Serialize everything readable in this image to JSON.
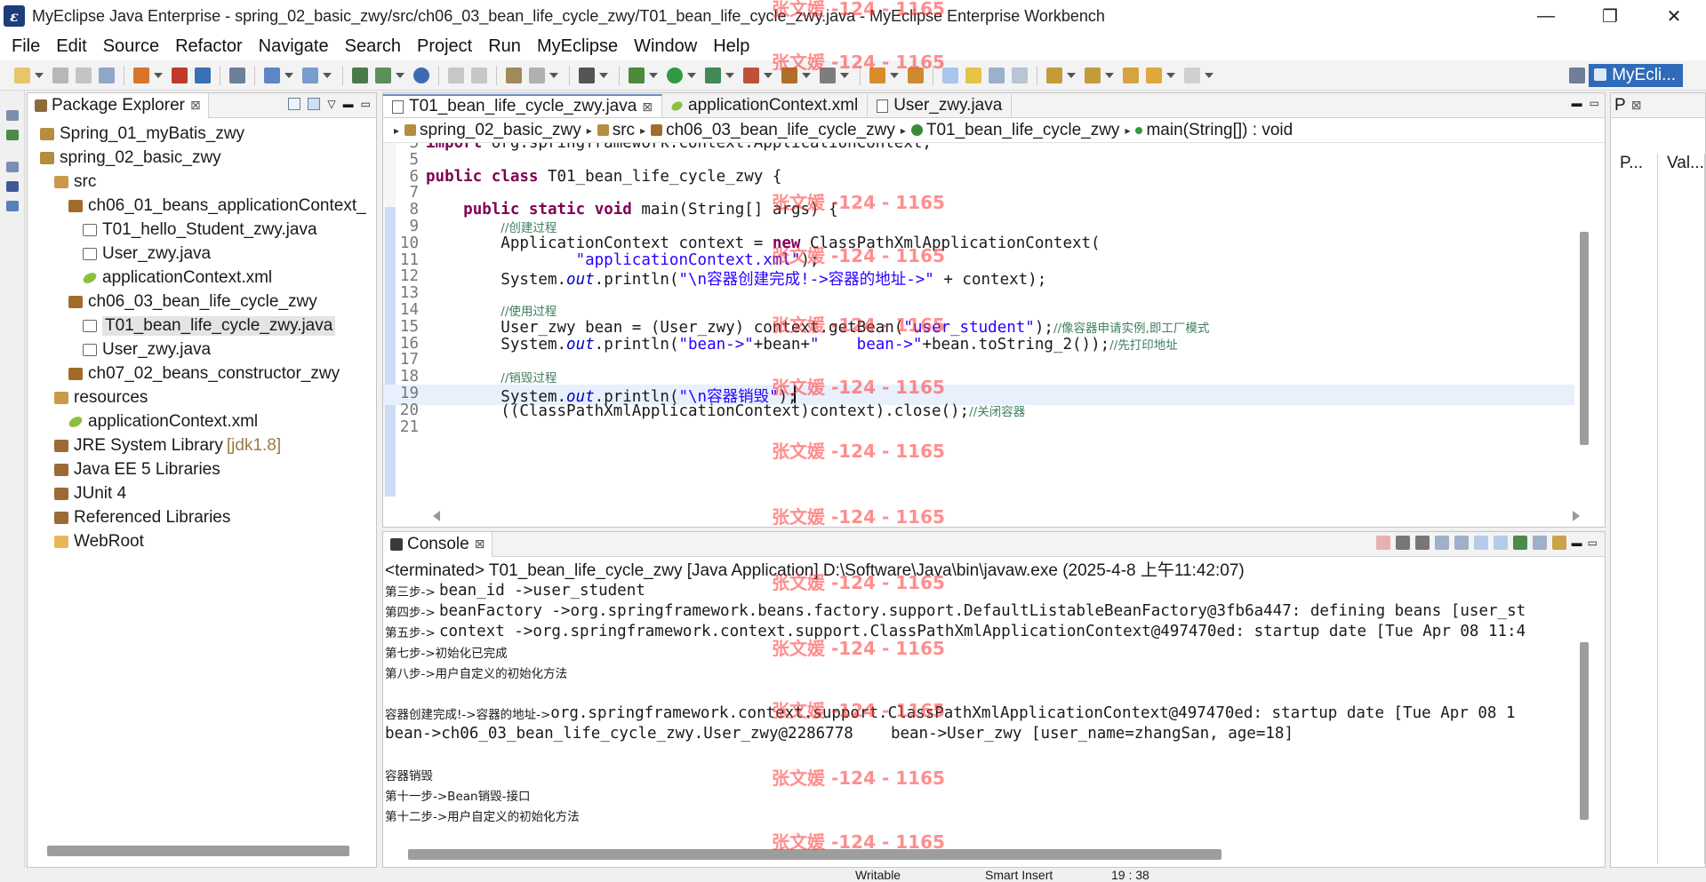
{
  "window": {
    "title": "MyEclipse Java Enterprise - spring_02_basic_zwy/src/ch06_03_bean_life_cycle_zwy/T01_bean_life_cycle_zwy.java - MyEclipse Enterprise Workbench",
    "minimize": "—",
    "maximize": "❐",
    "close": "✕"
  },
  "menu": [
    "File",
    "Edit",
    "Source",
    "Refactor",
    "Navigate",
    "Search",
    "Project",
    "Run",
    "MyEclipse",
    "Window",
    "Help"
  ],
  "perspective": {
    "label": "MyEcli..."
  },
  "package_explorer": {
    "title": "Package Explorer",
    "tree": [
      {
        "label": "Spring_01_myBatis_zwy",
        "icon": "project-icon",
        "depth": 1
      },
      {
        "label": "spring_02_basic_zwy",
        "icon": "project-icon",
        "depth": 1
      },
      {
        "label": "src",
        "icon": "source-folder-icon",
        "depth": 2
      },
      {
        "label": "ch06_01_beans_applicationContext_",
        "icon": "package-icon",
        "depth": 3
      },
      {
        "label": "T01_hello_Student_zwy.java",
        "icon": "java-file-icon",
        "depth": 4
      },
      {
        "label": "User_zwy.java",
        "icon": "java-file-icon",
        "depth": 4
      },
      {
        "label": "applicationContext.xml",
        "icon": "xml-file-icon",
        "depth": 4
      },
      {
        "label": "ch06_03_bean_life_cycle_zwy",
        "icon": "package-icon",
        "depth": 3
      },
      {
        "label": "T01_bean_life_cycle_zwy.java",
        "icon": "java-file-icon",
        "depth": 4,
        "selected": true
      },
      {
        "label": "User_zwy.java",
        "icon": "java-file-icon",
        "depth": 4
      },
      {
        "label": "ch07_02_beans_constructor_zwy",
        "icon": "package-icon",
        "depth": 3
      },
      {
        "label": "resources",
        "icon": "source-folder-icon",
        "depth": 2
      },
      {
        "label": "applicationContext.xml",
        "icon": "xml-file-icon",
        "depth": 3
      },
      {
        "label": "JRE System Library",
        "extra": "[jdk1.8]",
        "icon": "library-icon",
        "depth": 2
      },
      {
        "label": "Java EE 5 Libraries",
        "icon": "library-icon",
        "depth": 2
      },
      {
        "label": "JUnit 4",
        "icon": "library-icon",
        "depth": 2
      },
      {
        "label": "Referenced Libraries",
        "icon": "library-icon",
        "depth": 2
      },
      {
        "label": "WebRoot",
        "icon": "folder-icon",
        "depth": 2
      }
    ]
  },
  "editor": {
    "tabs": [
      {
        "label": "T01_bean_life_cycle_zwy.java",
        "active": true,
        "icon": "java-file-icon"
      },
      {
        "label": "applicationContext.xml",
        "active": false,
        "icon": "xml-file-icon"
      },
      {
        "label": "User_zwy.java",
        "active": false,
        "icon": "java-file-icon"
      }
    ],
    "breadcrumb": [
      "spring_02_basic_zwy",
      "src",
      "ch06_03_bean_life_cycle_zwy",
      "T01_bean_life_cycle_zwy",
      "main(String[]) : void"
    ],
    "current_line": "19",
    "lines": [
      {
        "n": "3",
        "text": "import org.springframework.context.ApplicationContext;"
      },
      {
        "n": "5",
        "text": ""
      },
      {
        "n": "6",
        "text": "public class T01_bean_life_cycle_zwy {"
      },
      {
        "n": "7",
        "text": ""
      },
      {
        "n": "8",
        "text": "    public static void main(String[] args) {"
      },
      {
        "n": "9",
        "text": "        //创建过程"
      },
      {
        "n": "10",
        "text": "        ApplicationContext context = new ClassPathXmlApplicationContext("
      },
      {
        "n": "11",
        "text": "                \"applicationContext.xml\");"
      },
      {
        "n": "12",
        "text": "        System.out.println(\"\\n容器创建完成!->容器的地址->\" + context);"
      },
      {
        "n": "13",
        "text": ""
      },
      {
        "n": "14",
        "text": "        //使用过程"
      },
      {
        "n": "15",
        "text": "        User_zwy bean = (User_zwy) context.getBean(\"user_student\");//像容器申请实例,即工厂模式"
      },
      {
        "n": "16",
        "text": "        System.out.println(\"bean->\"+bean+\"    bean->\"+bean.toString_2());//先打印地址"
      },
      {
        "n": "17",
        "text": ""
      },
      {
        "n": "18",
        "text": "        //销毁过程"
      },
      {
        "n": "19",
        "text": "        System.out.println(\"\\n容器销毁\");"
      },
      {
        "n": "20",
        "text": "        ((ClassPathXmlApplicationContext)context).close();//关闭容器"
      },
      {
        "n": "21",
        "text": ""
      }
    ]
  },
  "console": {
    "title": "Console",
    "status": "<terminated> T01_bean_life_cycle_zwy [Java Application] D:\\Software\\Java\\bin\\javaw.exe (2025-4-8 上午11:42:07)",
    "lines": [
      {
        "cn": "第三步-> ",
        "rest": "bean_id ->user_student"
      },
      {
        "cn": "第四步-> ",
        "rest": "beanFactory ->org.springframework.beans.factory.support.DefaultListableBeanFactory@3fb6a447: defining beans [user_st"
      },
      {
        "cn": "第五步-> ",
        "rest": "context ->org.springframework.context.support.ClassPathXmlApplicationContext@497470ed: startup date [Tue Apr 08 11:4"
      },
      {
        "cn": "第七步->初始化已完成",
        "rest": ""
      },
      {
        "cn": "第八步->用户自定义的初始化方法",
        "rest": ""
      },
      {
        "cn": "",
        "rest": ""
      },
      {
        "cn": "容器创建完成!->容器的地址->",
        "rest": "org.springframework.context.support.ClassPathXmlApplicationContext@497470ed: startup date [Tue Apr 08 1"
      },
      {
        "cn": "",
        "rest": "bean->ch06_03_bean_life_cycle_zwy.User_zwy@2286778    bean->User_zwy [user_name=zhangSan, age=18]"
      },
      {
        "cn": "",
        "rest": ""
      },
      {
        "cn": "容器销毁",
        "rest": ""
      },
      {
        "cn": "第十一步->Bean销毁-接口",
        "rest": ""
      },
      {
        "cn": "第十二步->用户自定义的初始化方法",
        "rest": ""
      }
    ]
  },
  "properties": {
    "tab": "P",
    "col1": "P...",
    "col2": "Val..."
  },
  "statusbar": {
    "writable": "Writable",
    "insert": "Smart Insert",
    "position": "19 : 38"
  },
  "watermark": "张文媛 -124 - 1165"
}
